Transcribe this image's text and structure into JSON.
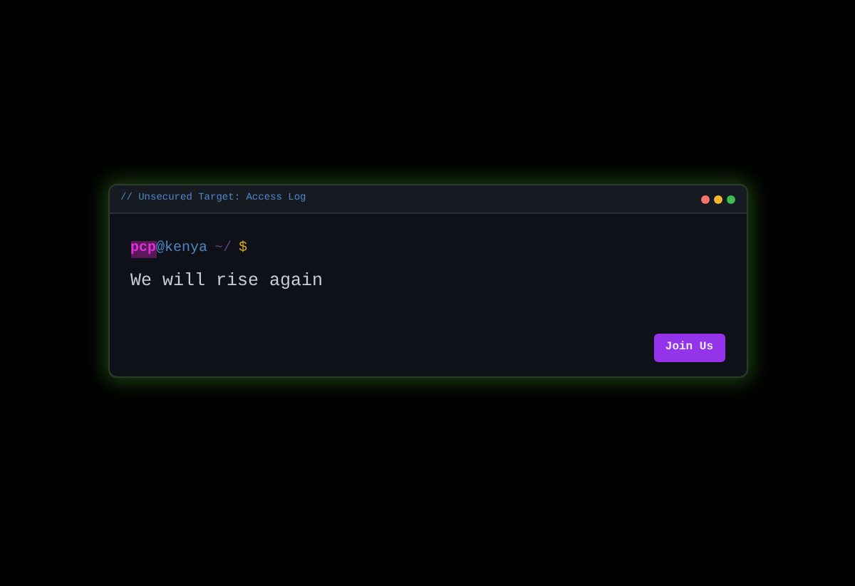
{
  "window": {
    "title": "// Unsecured Target: Access Log"
  },
  "prompt": {
    "user": "pcp",
    "host": "@kenya",
    "path": "~/",
    "symbol": "$"
  },
  "output": "We will rise again",
  "button": {
    "label": "Join Us"
  }
}
